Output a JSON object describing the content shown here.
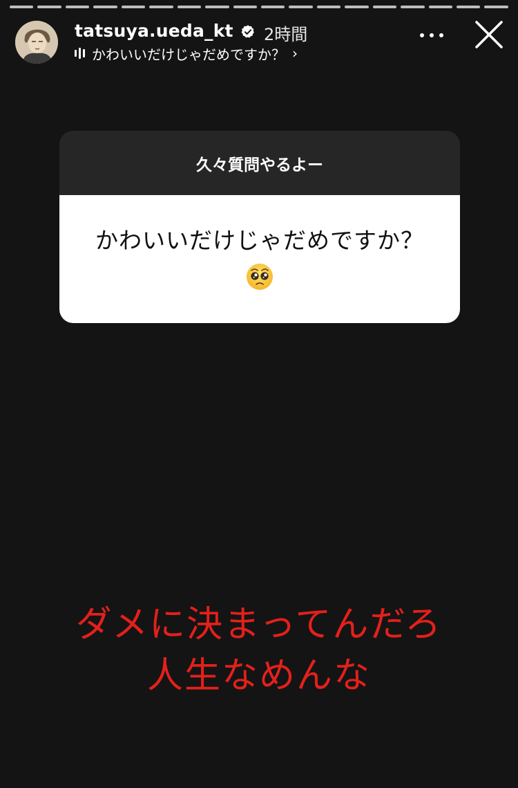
{
  "story": {
    "segment_count": 18
  },
  "header": {
    "username": "tatsuya.ueda_kt",
    "time": "2時間",
    "subline": "かわいいだけじゃだめですか？",
    "chevron": "›"
  },
  "question_card": {
    "prompt": "久々質問やるよー",
    "question": "かわいいだけじゃだめですか？",
    "emoji": "pleading-face"
  },
  "answer": {
    "line1": "ダメに決まってんだろ",
    "line2": "人生なめんな"
  },
  "colors": {
    "answer_text": "#e4201b",
    "background": "#141414",
    "card_header": "#262626"
  }
}
